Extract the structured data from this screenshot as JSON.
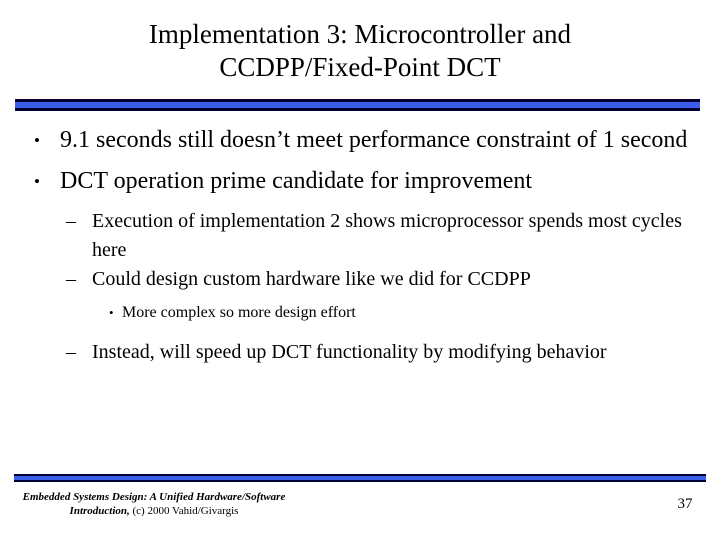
{
  "slide": {
    "title_lines": [
      "Implementation 3: Microcontroller and",
      "CCDPP/Fixed-Point DCT"
    ],
    "accent_color": "#3b5ee8",
    "accent_border_color": "#000033",
    "background_color": "#ffffff",
    "text_color": "#000000"
  },
  "bullets": [
    {
      "level": 1,
      "marker": "•",
      "text": "9.1 seconds still doesn’t meet performance constraint of 1 second"
    },
    {
      "level": 1,
      "marker": "•",
      "text": "DCT operation prime candidate for improvement"
    },
    {
      "level": 2,
      "marker": "–",
      "text": "Execution of implementation 2 shows microprocessor spends most cycles here"
    },
    {
      "level": 2,
      "marker": "–",
      "text": "Could design custom hardware like we did for CCDPP"
    },
    {
      "level": 3,
      "marker": "•",
      "text": "More complex so more design effort"
    },
    {
      "level": 2,
      "marker": "–",
      "text": "Instead, will speed up DCT functionality by modifying behavior"
    }
  ],
  "footer": {
    "citation_italic": "Embedded Systems Design: A Unified Hardware/Software Introduction,",
    "citation_plain": " (c) 2000 Vahid/Givargis",
    "page_number": "37"
  }
}
